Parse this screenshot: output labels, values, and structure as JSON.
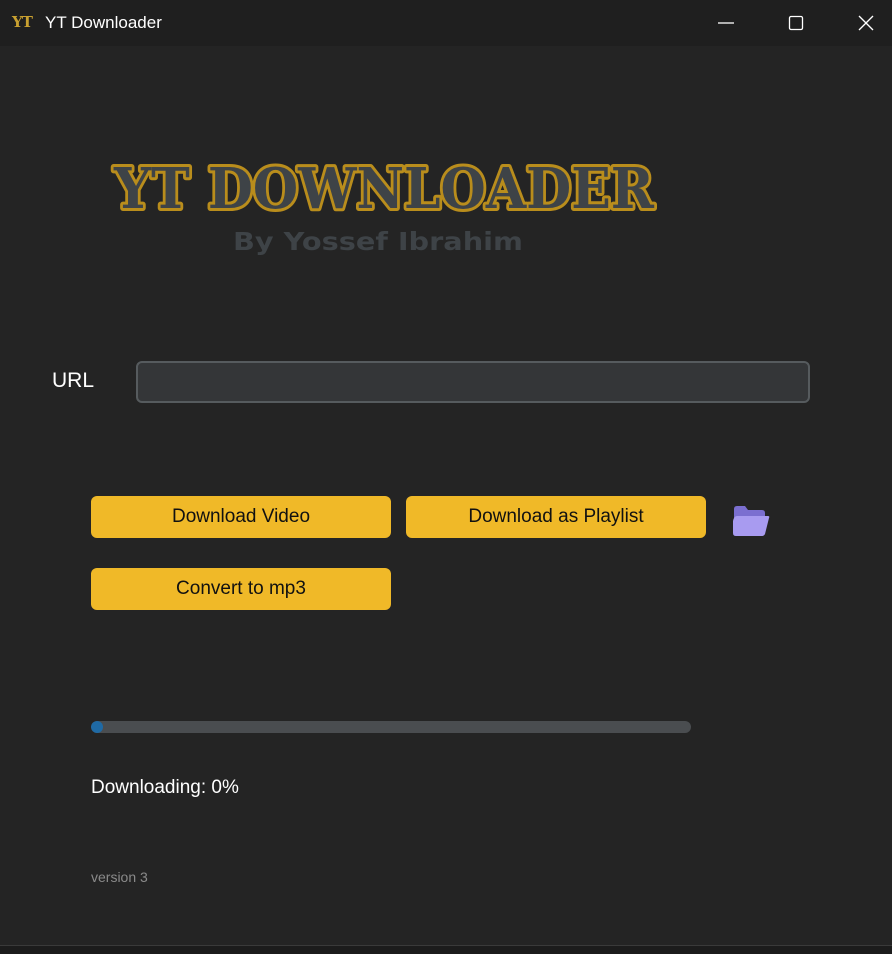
{
  "window": {
    "title": "YT Downloader",
    "icon": "yt-logo-icon",
    "icon_text": "YT",
    "controls": [
      "minimize-icon",
      "maximize-icon",
      "close-icon"
    ]
  },
  "logo": {
    "title": "YT DOWNLOADER",
    "subtitle": "By Yossef Ibrahim",
    "fill_color": "#3e4347",
    "outline_color": "#b98d1c"
  },
  "form": {
    "url_label": "URL",
    "url_value": "",
    "url_placeholder": ""
  },
  "buttons": {
    "download_video": "Download Video",
    "download_playlist": "Download as Playlist",
    "convert_mp3": "Convert to mp3",
    "folder_icon": "folder-icon"
  },
  "progress": {
    "status": "Downloading: 0%",
    "value": 0
  },
  "footer": {
    "version": "version 3"
  },
  "colors": {
    "accent": "#f0b928",
    "progress": "#1f6aa5",
    "background": "#242424",
    "folder": "#9b8ee6"
  }
}
